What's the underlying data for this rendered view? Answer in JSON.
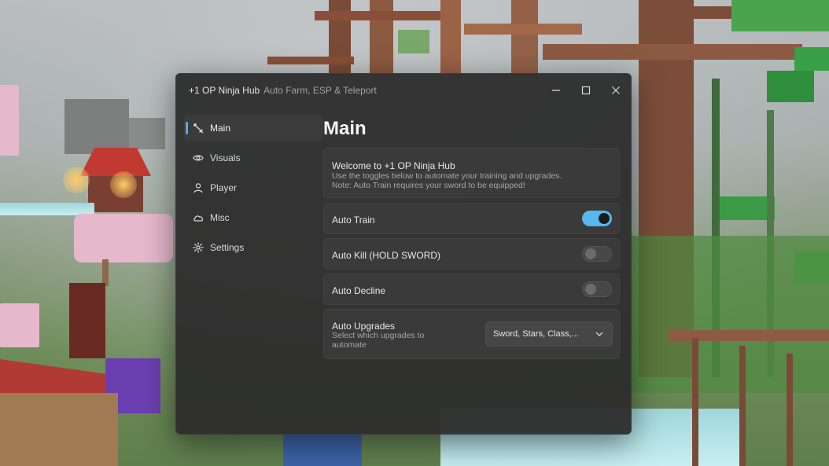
{
  "window": {
    "title": "+1 OP Ninja Hub",
    "subtitle": "Auto Farm, ESP & Teleport",
    "controls": [
      "minimize-icon",
      "maximize-icon",
      "close-icon"
    ]
  },
  "sidebar": {
    "items": [
      {
        "label": "Main",
        "icon": "sword-icon",
        "active": true
      },
      {
        "label": "Visuals",
        "icon": "eye-icon",
        "active": false
      },
      {
        "label": "Player",
        "icon": "user-icon",
        "active": false
      },
      {
        "label": "Misc",
        "icon": "cloud-icon",
        "active": false
      },
      {
        "label": "Settings",
        "icon": "gear-icon",
        "active": false
      }
    ]
  },
  "main": {
    "title": "Main",
    "welcome": {
      "heading": "Welcome to +1 OP Ninja Hub",
      "line1": "Use the toggles below to automate your training and upgrades.",
      "line2": "Note: Auto Train requires your sword to be equipped!"
    },
    "toggles": [
      {
        "label": "Auto Train",
        "on": true
      },
      {
        "label": "Auto Kill (HOLD SWORD)",
        "on": false
      },
      {
        "label": "Auto Decline",
        "on": false
      }
    ],
    "upgrades": {
      "label": "Auto Upgrades",
      "description": "Select which upgrades to automate",
      "selected": "Sword, Stars, Class,..."
    }
  },
  "colors": {
    "accent": "#56b8ee",
    "window_bg": "#2e2e2e",
    "card_bg": "#3a3a3a"
  }
}
